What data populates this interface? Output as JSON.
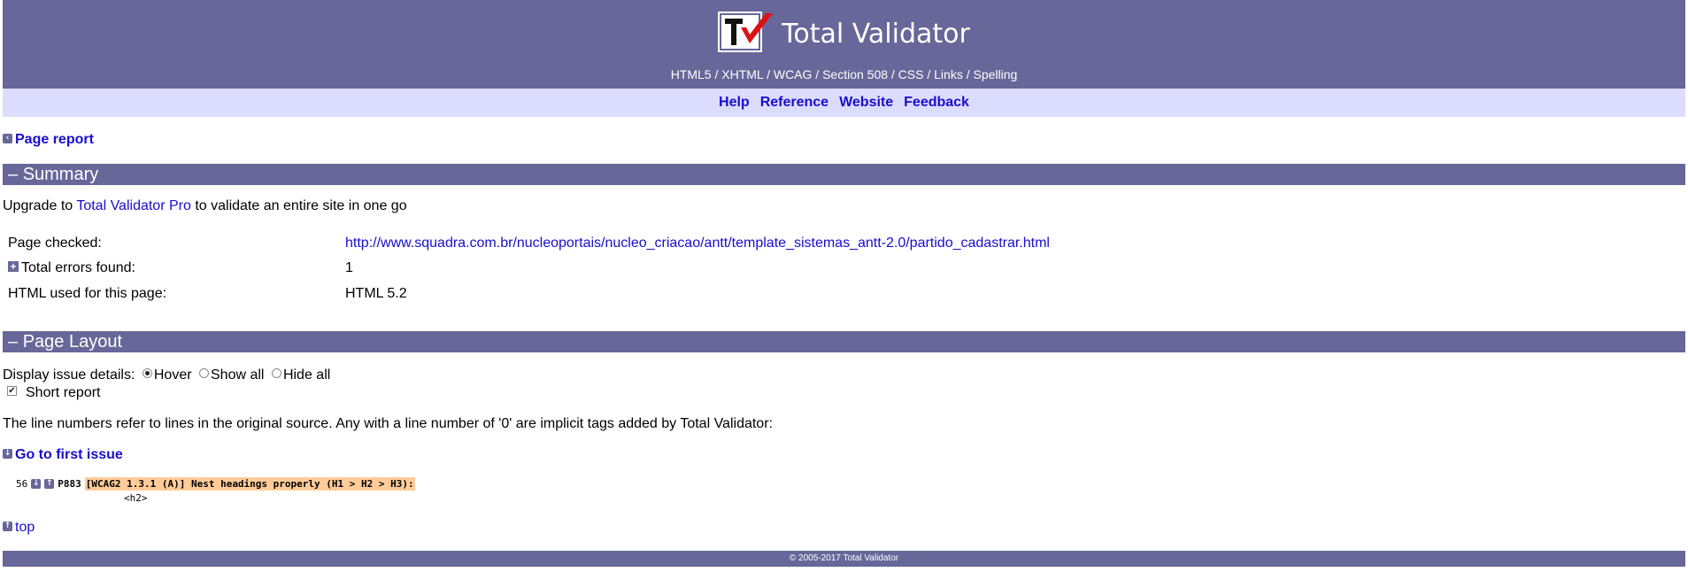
{
  "header": {
    "title": "Total Validator",
    "tagline": "HTML5 / XHTML / WCAG / Section 508 / CSS / Links / Spelling",
    "logo_icon": "tv-checkmark-logo"
  },
  "nav": [
    "Help",
    "Reference",
    "Website",
    "Feedback"
  ],
  "page_report_link": "Page report",
  "summary": {
    "heading": "Summary",
    "collapse_glyph": "–",
    "upgrade_pre": "Upgrade to ",
    "upgrade_link": "Total Validator Pro",
    "upgrade_post": " to validate an entire site in one go",
    "rows": [
      {
        "label": "Page checked:",
        "value": "http://www.squadra.com.br/nucleoportais/nucleo_criacao/antt/template_sistemas_antt-2.0/partido_cadastrar.html"
      },
      {
        "label": "Total errors found:",
        "value": "1"
      },
      {
        "label": "HTML used for this page:",
        "value": "HTML 5.2"
      }
    ]
  },
  "layout": {
    "heading": "Page Layout",
    "display_label": "Display issue details:",
    "options": [
      "Hover",
      "Show all",
      "Hide all"
    ],
    "selected_option": "Hover",
    "short_report_label": "Short report",
    "short_report_checked": true,
    "note": "The line numbers refer to lines in the original source. Any with a line number of '0' are implicit tags added by Total Validator:",
    "first_issue_link": "Go to first issue"
  },
  "issue": {
    "line_number": "56",
    "code": "P883",
    "message": "[WCAG2 1.3.1 (A)] Nest headings properly (H1 > H2 > H3):",
    "tag": "<h2>"
  },
  "top_link": "top",
  "footer": "© 2005-2017 Total Validator",
  "colors": {
    "bar": "#676799",
    "nav_bg": "#dcdcff",
    "link": "#1a0dcc",
    "highlight": "#ffcc99"
  }
}
